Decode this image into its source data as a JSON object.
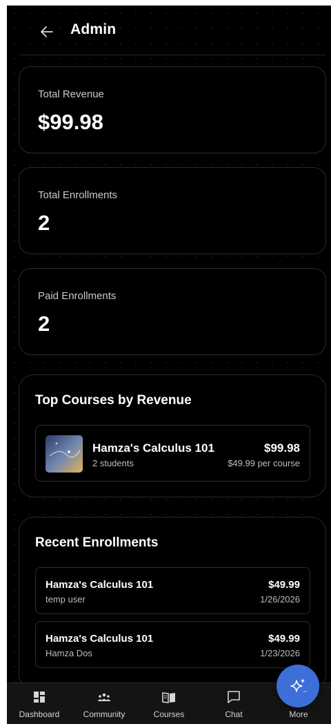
{
  "header": {
    "title": "Admin",
    "back_icon": "arrow-left-icon"
  },
  "stats": [
    {
      "label": "Total Revenue",
      "value": "$99.98"
    },
    {
      "label": "Total Enrollments",
      "value": "2"
    },
    {
      "label": "Paid Enrollments",
      "value": "2"
    }
  ],
  "top_courses": {
    "title": "Top Courses by Revenue",
    "items": [
      {
        "name": "Hamza's Calculus 101",
        "students": "2 students",
        "revenue": "$99.98",
        "per_course": "$49.99 per course"
      }
    ]
  },
  "recent_enrollments": {
    "title": "Recent Enrollments",
    "items": [
      {
        "course": "Hamza's Calculus 101",
        "user": "temp user",
        "price": "$49.99",
        "date": "1/26/2026"
      },
      {
        "course": "Hamza's Calculus 101",
        "user": "Hamza Dos",
        "price": "$49.99",
        "date": "1/23/2026"
      }
    ]
  },
  "bottom_nav": {
    "items": [
      {
        "label": "Dashboard",
        "icon": "dashboard-icon"
      },
      {
        "label": "Community",
        "icon": "community-icon"
      },
      {
        "label": "Courses",
        "icon": "book-icon"
      },
      {
        "label": "Chat",
        "icon": "chat-icon"
      },
      {
        "label": "More",
        "icon": "more-icon"
      }
    ]
  },
  "fab": {
    "icon": "sparkle-icon"
  },
  "colors": {
    "background": "#000000",
    "card_border": "#2b2b2b",
    "fab": "#3d6fd9",
    "nav_bg": "#141414"
  }
}
